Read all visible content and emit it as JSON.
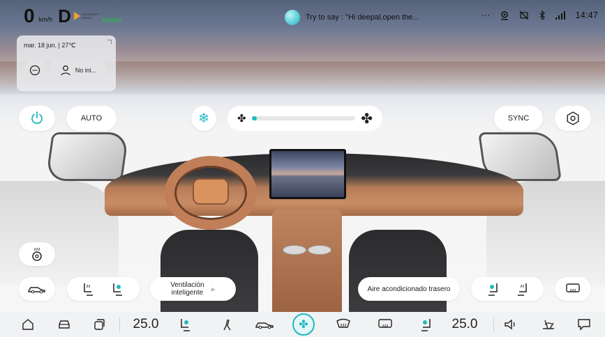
{
  "status_bar": {
    "speed": "0",
    "speed_unit": "km/h",
    "gear": "D",
    "airbag_label": "PASSENGER AIRBAG",
    "ready": "READY",
    "voice_prompt": "Try to say : \"Hi deepal,open the...",
    "more": "···",
    "time": "14:47"
  },
  "info_card": {
    "date_weather": "mar. 18 jun. | 27℃",
    "profile_label": "No ini..."
  },
  "climate_top": {
    "auto_label": "AUTO",
    "sync_label": "SYNC",
    "fan_level": 0.05
  },
  "climate_bottom": {
    "ventilation_label": "Ventilación\ninteligente",
    "rear_ac_label": "Aire acondicionado trasero"
  },
  "dock": {
    "temp_left": "25.0",
    "temp_right": "25.0"
  },
  "colors": {
    "accent": "#20b8c2",
    "ready": "#2fb64e",
    "airbag": "#f0a030"
  },
  "icons": [
    "power-icon",
    "snowflake-icon",
    "fan-icon",
    "recirculation-icon",
    "steering-heat-icon",
    "car-icon",
    "seat-heat-icon",
    "seat-vent-icon",
    "defrost-icon",
    "home-icon",
    "volume-icon",
    "location-icon",
    "bluetooth-icon",
    "signal-icon"
  ]
}
